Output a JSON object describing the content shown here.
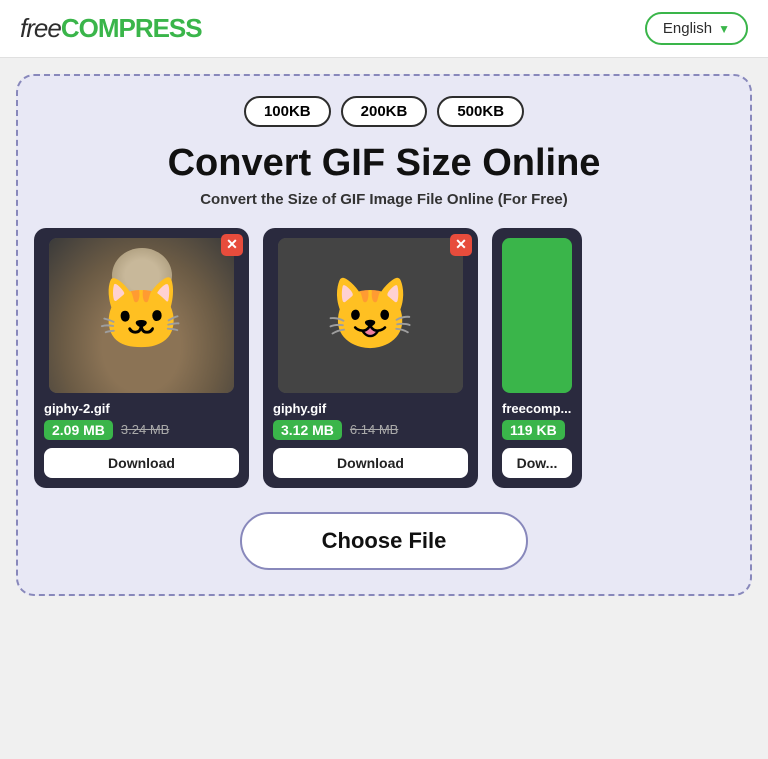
{
  "header": {
    "logo_free": "free",
    "logo_compress": "COMPRESS",
    "language_label": "English",
    "chevron": "▼"
  },
  "toolbar": {
    "size_btn_1": "100KB",
    "size_btn_2": "200KB",
    "size_btn_3": "500KB"
  },
  "hero": {
    "title": "Convert GIF Size Online",
    "subtitle": "Convert the Size of GIF Image File Online (For Free)"
  },
  "files": [
    {
      "name": "giphy-2.gif",
      "size_new": "2.09 MB",
      "size_old": "3.24 MB",
      "download_label": "Download"
    },
    {
      "name": "giphy.gif",
      "size_new": "3.12 MB",
      "size_old": "6.14 MB",
      "download_label": "Download"
    },
    {
      "name": "freecomp...",
      "size_new": "119 KB",
      "size_old": "",
      "download_label": "Dow..."
    }
  ],
  "choose_file": {
    "label": "Choose File"
  }
}
